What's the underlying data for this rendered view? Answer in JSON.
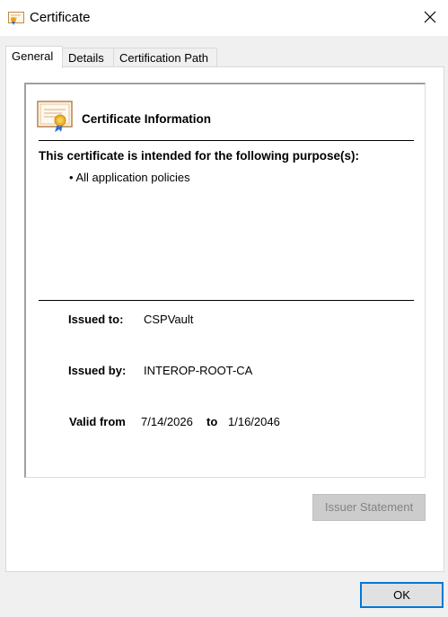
{
  "window": {
    "title": "Certificate",
    "icon": "certificate-icon",
    "close_icon": "close-icon"
  },
  "tabs": [
    {
      "label": "General",
      "active": true
    },
    {
      "label": "Details",
      "active": false
    },
    {
      "label": "Certification Path",
      "active": false
    }
  ],
  "general": {
    "info_title": "Certificate Information",
    "purpose_heading": "This certificate is intended for the following purpose(s):",
    "purposes": [
      "• All application policies"
    ],
    "issued_to_label": "Issued to:",
    "issued_to_value": "CSPVault",
    "issued_by_label": "Issued by:",
    "issued_by_value": "INTEROP-ROOT-CA",
    "valid_from_label": "Valid from",
    "valid_from_value": "7/14/2026",
    "valid_to_label": "to",
    "valid_to_value": "1/16/2046"
  },
  "buttons": {
    "issuer_statement": "Issuer Statement",
    "issuer_statement_enabled": false,
    "ok": "OK"
  },
  "colors": {
    "accent": "#0078d7",
    "disabled_button_bg": "#cccccc",
    "disabled_text": "#838383"
  }
}
